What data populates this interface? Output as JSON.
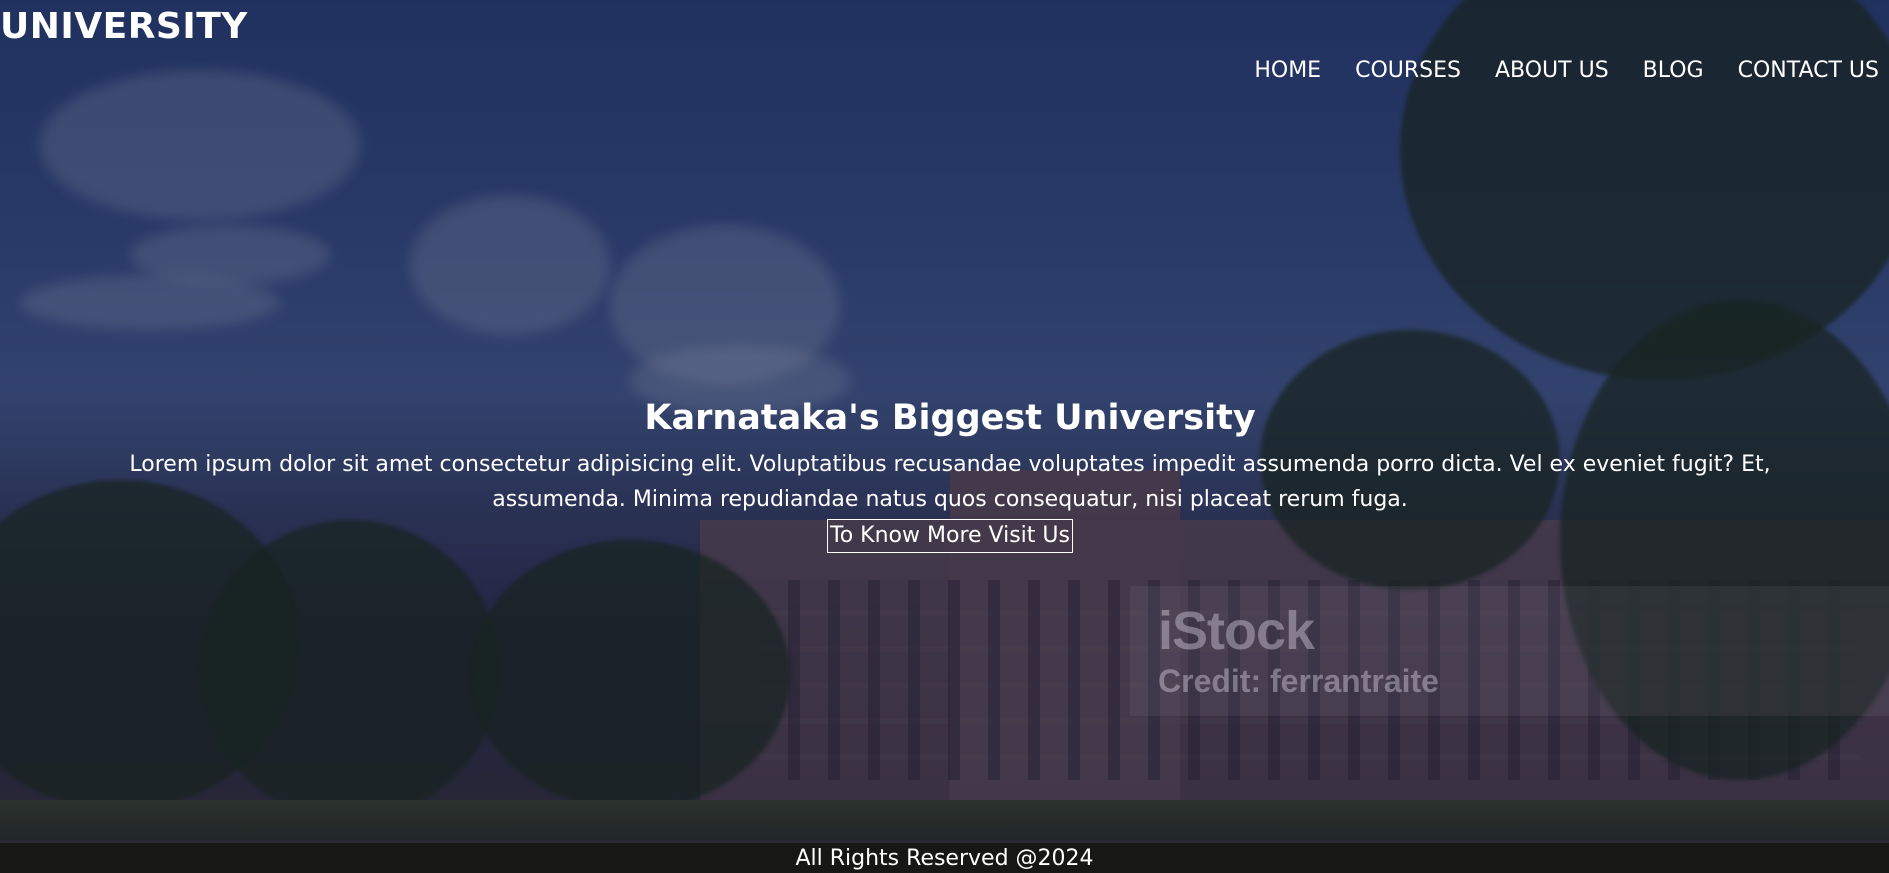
{
  "header": {
    "logo": "UNIVERSITY",
    "nav": [
      {
        "label": "HOME"
      },
      {
        "label": "COURSES"
      },
      {
        "label": "ABOUT US"
      },
      {
        "label": "BLOG"
      },
      {
        "label": "CONTACT US"
      }
    ]
  },
  "hero": {
    "headline": "Karnataka's Biggest University",
    "paragraph": "Lorem ipsum dolor sit amet consectetur adipisicing elit. Voluptatibus recusandae voluptates impedit assumenda porro dicta. Vel ex eveniet fugit? Et, assumenda. Minima repudiandae natus quos consequatur, nisi placeat rerum fuga.",
    "cta_label": "To Know More Visit Us"
  },
  "watermark": {
    "logo": "iStock",
    "credit": "Credit: ferrantraite"
  },
  "footer": {
    "text": "All Rights Reserved @2024"
  },
  "colors": {
    "text": "#ffffff",
    "footer_bg": "#171713",
    "overlay": "#161430"
  }
}
